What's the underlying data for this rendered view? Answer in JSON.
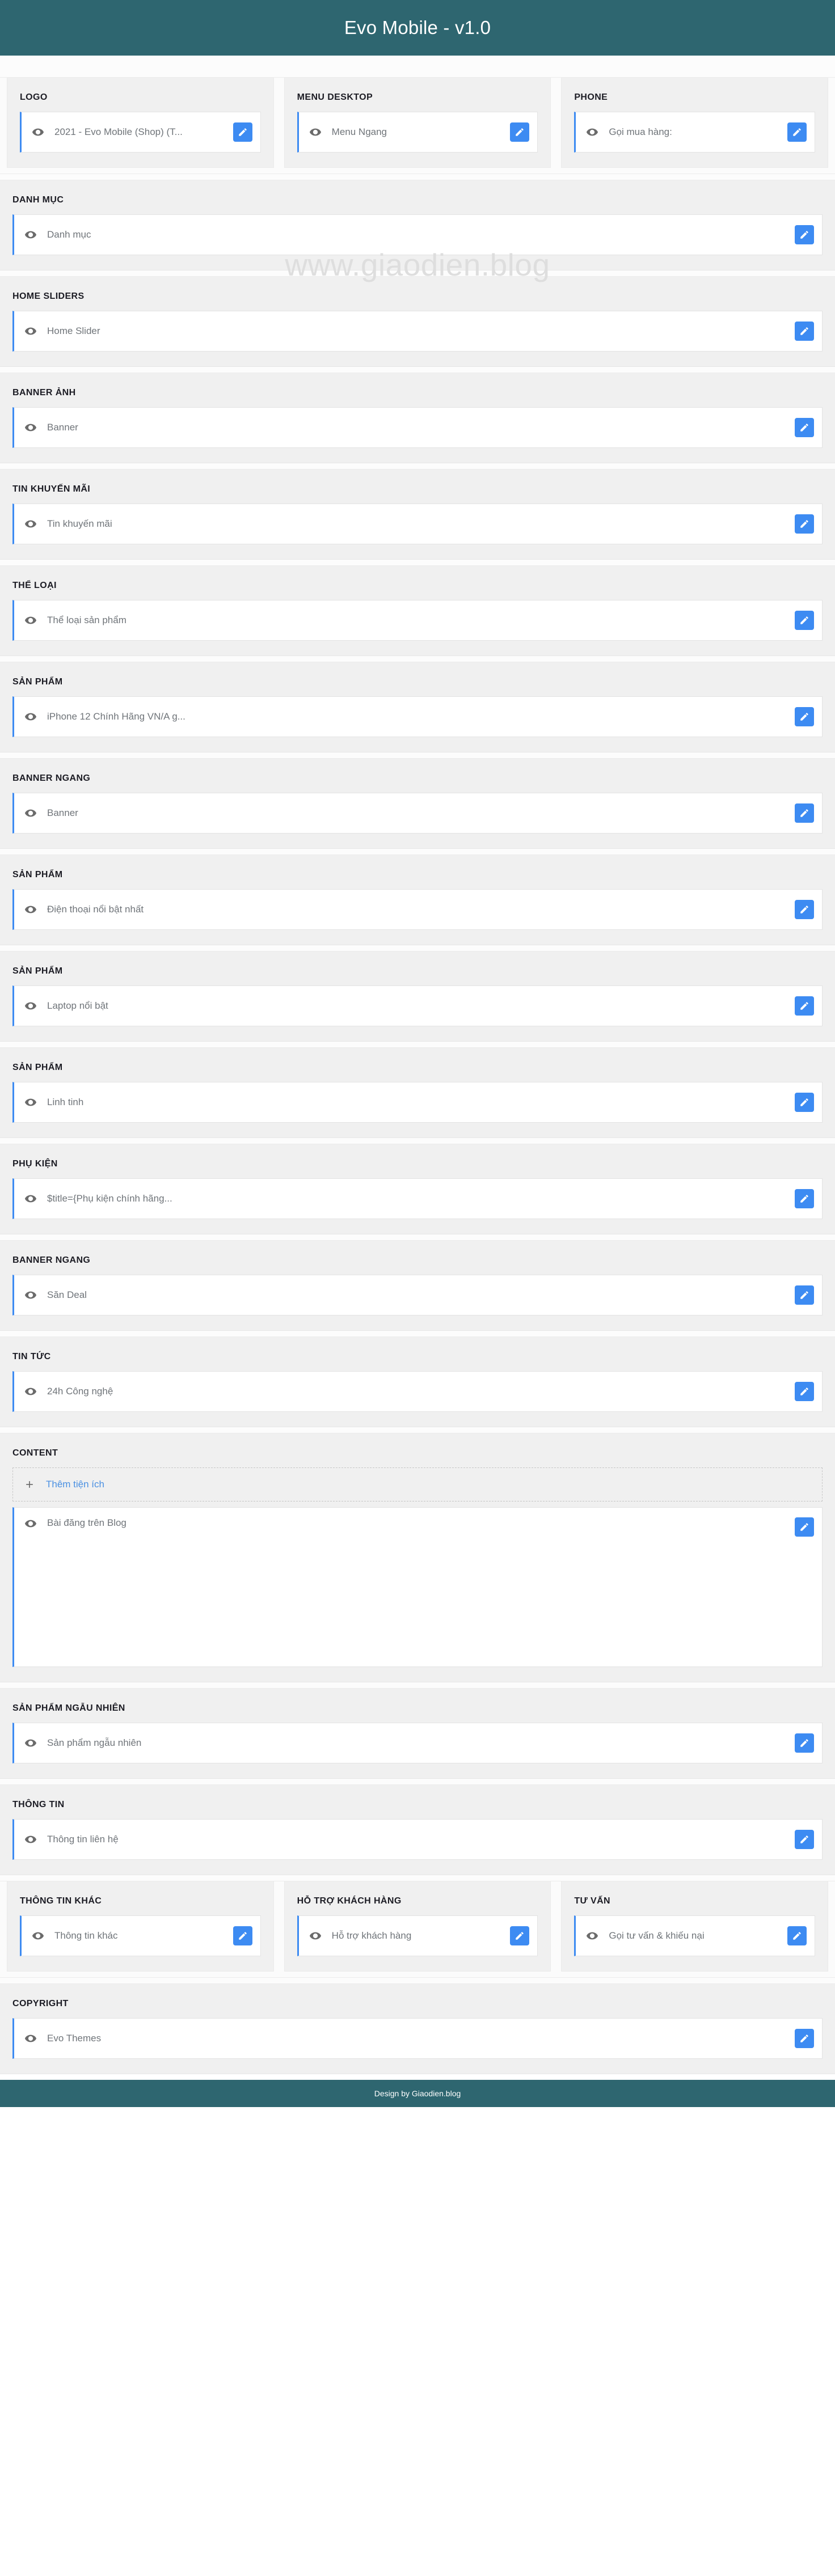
{
  "header": {
    "title": "Evo Mobile - v1.0"
  },
  "watermark": "www.giaodien.blog",
  "icons": {
    "visibility": "eye-icon",
    "edit": "pencil-icon",
    "add": "plus-icon"
  },
  "colors": {
    "header_bg": "#2e6670",
    "footer_bg": "#2e6670",
    "accent_blue": "#3d8bf2",
    "section_bg": "#f0f0f0",
    "widget_bg": "#ffffff",
    "link_blue": "#4a90e2"
  },
  "top_row": [
    {
      "title": "LOGO",
      "widget": "2021 - Evo Mobile (Shop) (T..."
    },
    {
      "title": "MENU DESKTOP",
      "widget": "Menu Ngang"
    },
    {
      "title": "PHONE",
      "widget": "Gọi mua hàng:"
    }
  ],
  "sections": [
    {
      "title": "DANH MỤC",
      "widget": "Danh mục"
    },
    {
      "title": "HOME SLIDERS",
      "widget": "Home Slider"
    },
    {
      "title": "BANNER ẢNH",
      "widget": "Banner"
    },
    {
      "title": "TIN KHUYẾN MÃI",
      "widget": "Tin khuyến mãi"
    },
    {
      "title": "THỂ LOẠI",
      "widget": "Thể loại sản phẩm"
    },
    {
      "title": "SẢN PHẨM",
      "widget": "iPhone 12 Chính Hãng VN/A g..."
    },
    {
      "title": "BANNER NGANG",
      "widget": "Banner"
    },
    {
      "title": "SẢN PHẨM",
      "widget": "Điện thoại nổi bật nhất"
    },
    {
      "title": "SẢN PHẨM",
      "widget": "Laptop nổi bật"
    },
    {
      "title": "SẢN PHẨM",
      "widget": "Linh tinh"
    },
    {
      "title": "PHỤ KIỆN",
      "widget": "$title={Phụ kiện chính hãng..."
    },
    {
      "title": "BANNER NGANG",
      "widget": "Săn Deal"
    },
    {
      "title": "TIN TỨC",
      "widget": "24h Công nghệ"
    }
  ],
  "content_section": {
    "title": "CONTENT",
    "add_label": "Thêm tiện ích",
    "widget": "Bài đăng trên Blog"
  },
  "sections_after": [
    {
      "title": "SẢN PHẨM NGẪU NHIÊN",
      "widget": "Sản phẩm ngẫu nhiên"
    },
    {
      "title": "THÔNG TIN",
      "widget": "Thông tin liên hệ"
    }
  ],
  "bottom_row": [
    {
      "title": "THÔNG TIN KHÁC",
      "widget": "Thông tin khác"
    },
    {
      "title": "HỖ TRỢ KHÁCH HÀNG",
      "widget": "Hỗ trợ khách hàng"
    },
    {
      "title": "TƯ VẤN",
      "widget": "Gọi tư vấn & khiếu nại"
    }
  ],
  "copyright_section": {
    "title": "COPYRIGHT",
    "widget": "Evo Themes"
  },
  "footer": {
    "text": "Design by Giaodien.blog"
  }
}
